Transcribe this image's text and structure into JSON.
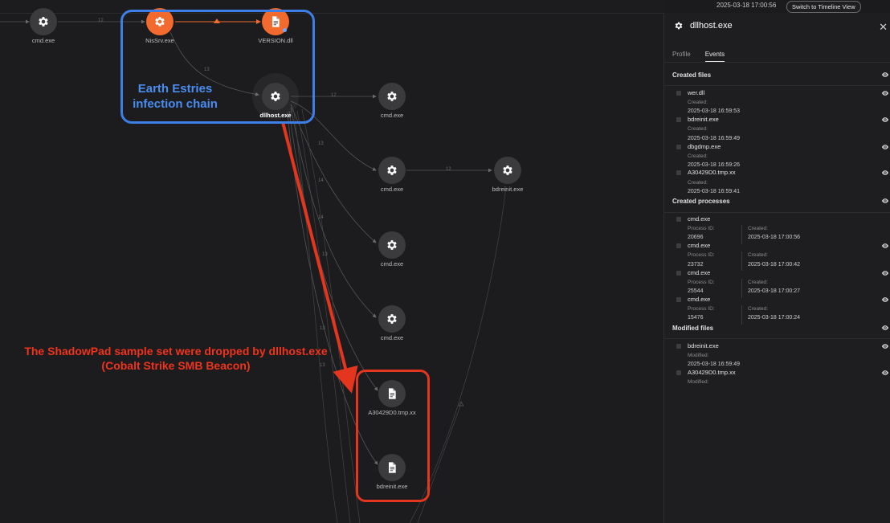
{
  "topbar": {
    "timestamp": "2025-03-18 17:00:56",
    "timeline_button": "Switch to Timeline View"
  },
  "graph": {
    "nodes": [
      {
        "id": "cmd-top",
        "label": "cmd.exe",
        "type": "process",
        "color": "gray"
      },
      {
        "id": "nissrv",
        "label": "NisSrv.exe",
        "type": "process",
        "color": "orange"
      },
      {
        "id": "version",
        "label": "VERSION.dll",
        "type": "file",
        "color": "orange"
      },
      {
        "id": "dllhost",
        "label": "dllhost.exe",
        "type": "process",
        "color": "gray",
        "selected": true
      },
      {
        "id": "cmd-1",
        "label": "cmd.exe",
        "type": "process",
        "color": "gray"
      },
      {
        "id": "cmd-2",
        "label": "cmd.exe",
        "type": "process",
        "color": "gray"
      },
      {
        "id": "bdreinit-proc",
        "label": "bdreinit.exe",
        "type": "process",
        "color": "gray"
      },
      {
        "id": "cmd-3",
        "label": "cmd.exe",
        "type": "process",
        "color": "gray"
      },
      {
        "id": "cmd-4",
        "label": "cmd.exe",
        "type": "process",
        "color": "gray"
      },
      {
        "id": "a30429d0",
        "label": "A30429D0.tmp.xx",
        "type": "file",
        "color": "gray"
      },
      {
        "id": "bdreinit-file",
        "label": "bdreinit.exe",
        "type": "file",
        "color": "gray"
      }
    ],
    "edge_labels": [
      "12",
      "12",
      "12",
      "13",
      "12",
      "12",
      "13",
      "14",
      "13",
      "14",
      "13",
      "13",
      "13"
    ]
  },
  "annotations": {
    "blue": "Earth Estries infection chain",
    "red": "The ShadowPad sample set were dropped by dllhost.exe (Cobalt Strike SMB Beacon)",
    "blue_color": "#3d7fe6",
    "red_color": "#e4351f",
    "accent_orange": "#f26a2e"
  },
  "panel": {
    "title": "dllhost.exe",
    "tabs": [
      {
        "label": "Profile",
        "active": false
      },
      {
        "label": "Events",
        "active": true
      }
    ],
    "created_files": {
      "heading": "Created files",
      "items": [
        {
          "name": "wer.dll",
          "sub": "Created:",
          "value": "2025-03-18 16:59:53"
        },
        {
          "name": "bdreinit.exe",
          "sub": "Created:",
          "value": "2025-03-18 16:59:49"
        },
        {
          "name": "dbgdmp.exe",
          "sub": "Created:",
          "value": "2025-03-18 16:59:26"
        },
        {
          "name": "A30429D0.tmp.xx",
          "sub": "Created:",
          "value": "2025-03-18 16:59:41"
        }
      ]
    },
    "created_processes": {
      "heading": "Created processes",
      "items": [
        {
          "name": "cmd.exe",
          "pid_label": "Process ID:",
          "pid": "20696",
          "created_label": "Created:",
          "created": "2025-03-18 17:00:56"
        },
        {
          "name": "cmd.exe",
          "pid_label": "Process ID:",
          "pid": "23732",
          "created_label": "Created:",
          "created": "2025-03-18 17:00:42"
        },
        {
          "name": "cmd.exe",
          "pid_label": "Process ID:",
          "pid": "25544",
          "created_label": "Created:",
          "created": "2025-03-18 17:00:27"
        },
        {
          "name": "cmd.exe",
          "pid_label": "Process ID:",
          "pid": "15476",
          "created_label": "Created:",
          "created": "2025-03-18 17:00:24"
        }
      ]
    },
    "modified_files": {
      "heading": "Modified files",
      "items": [
        {
          "name": "bdreinit.exe",
          "sub": "Modified:",
          "value": "2025-03-18 16:59:49"
        },
        {
          "name": "A30429D0.tmp.xx",
          "sub": "Modified:",
          "value": ""
        }
      ]
    }
  }
}
